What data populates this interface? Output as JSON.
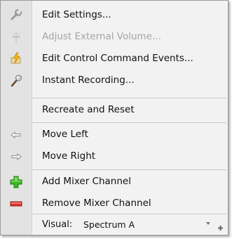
{
  "menu": {
    "items": [
      {
        "label": "Edit Settings...",
        "icon": "wrench-icon",
        "enabled": true
      },
      {
        "label": "Adjust External Volume...",
        "icon": "fader-icon",
        "enabled": false
      },
      {
        "label": "Edit Control Command Events...",
        "icon": "lightning-icon",
        "enabled": true
      },
      {
        "label": "Instant Recording...",
        "icon": "microphone-icon",
        "enabled": true
      },
      {
        "label": "Recreate and Reset",
        "icon": "",
        "enabled": true
      },
      {
        "label": "Move Left",
        "icon": "arrow-left-icon",
        "enabled": true
      },
      {
        "label": "Move Right",
        "icon": "arrow-right-icon",
        "enabled": true
      },
      {
        "label": "Add Mixer Channel",
        "icon": "plus-icon",
        "enabled": true
      },
      {
        "label": "Remove Mixer Channel",
        "icon": "minus-icon",
        "enabled": true
      }
    ],
    "visual": {
      "label": "Visual:",
      "value": "Spectrum A"
    }
  },
  "colors": {
    "gutter": "#e3e3e3",
    "menu_bg": "#f2f2f2",
    "add_green": "#3cb528",
    "remove_red": "#e0342a"
  }
}
